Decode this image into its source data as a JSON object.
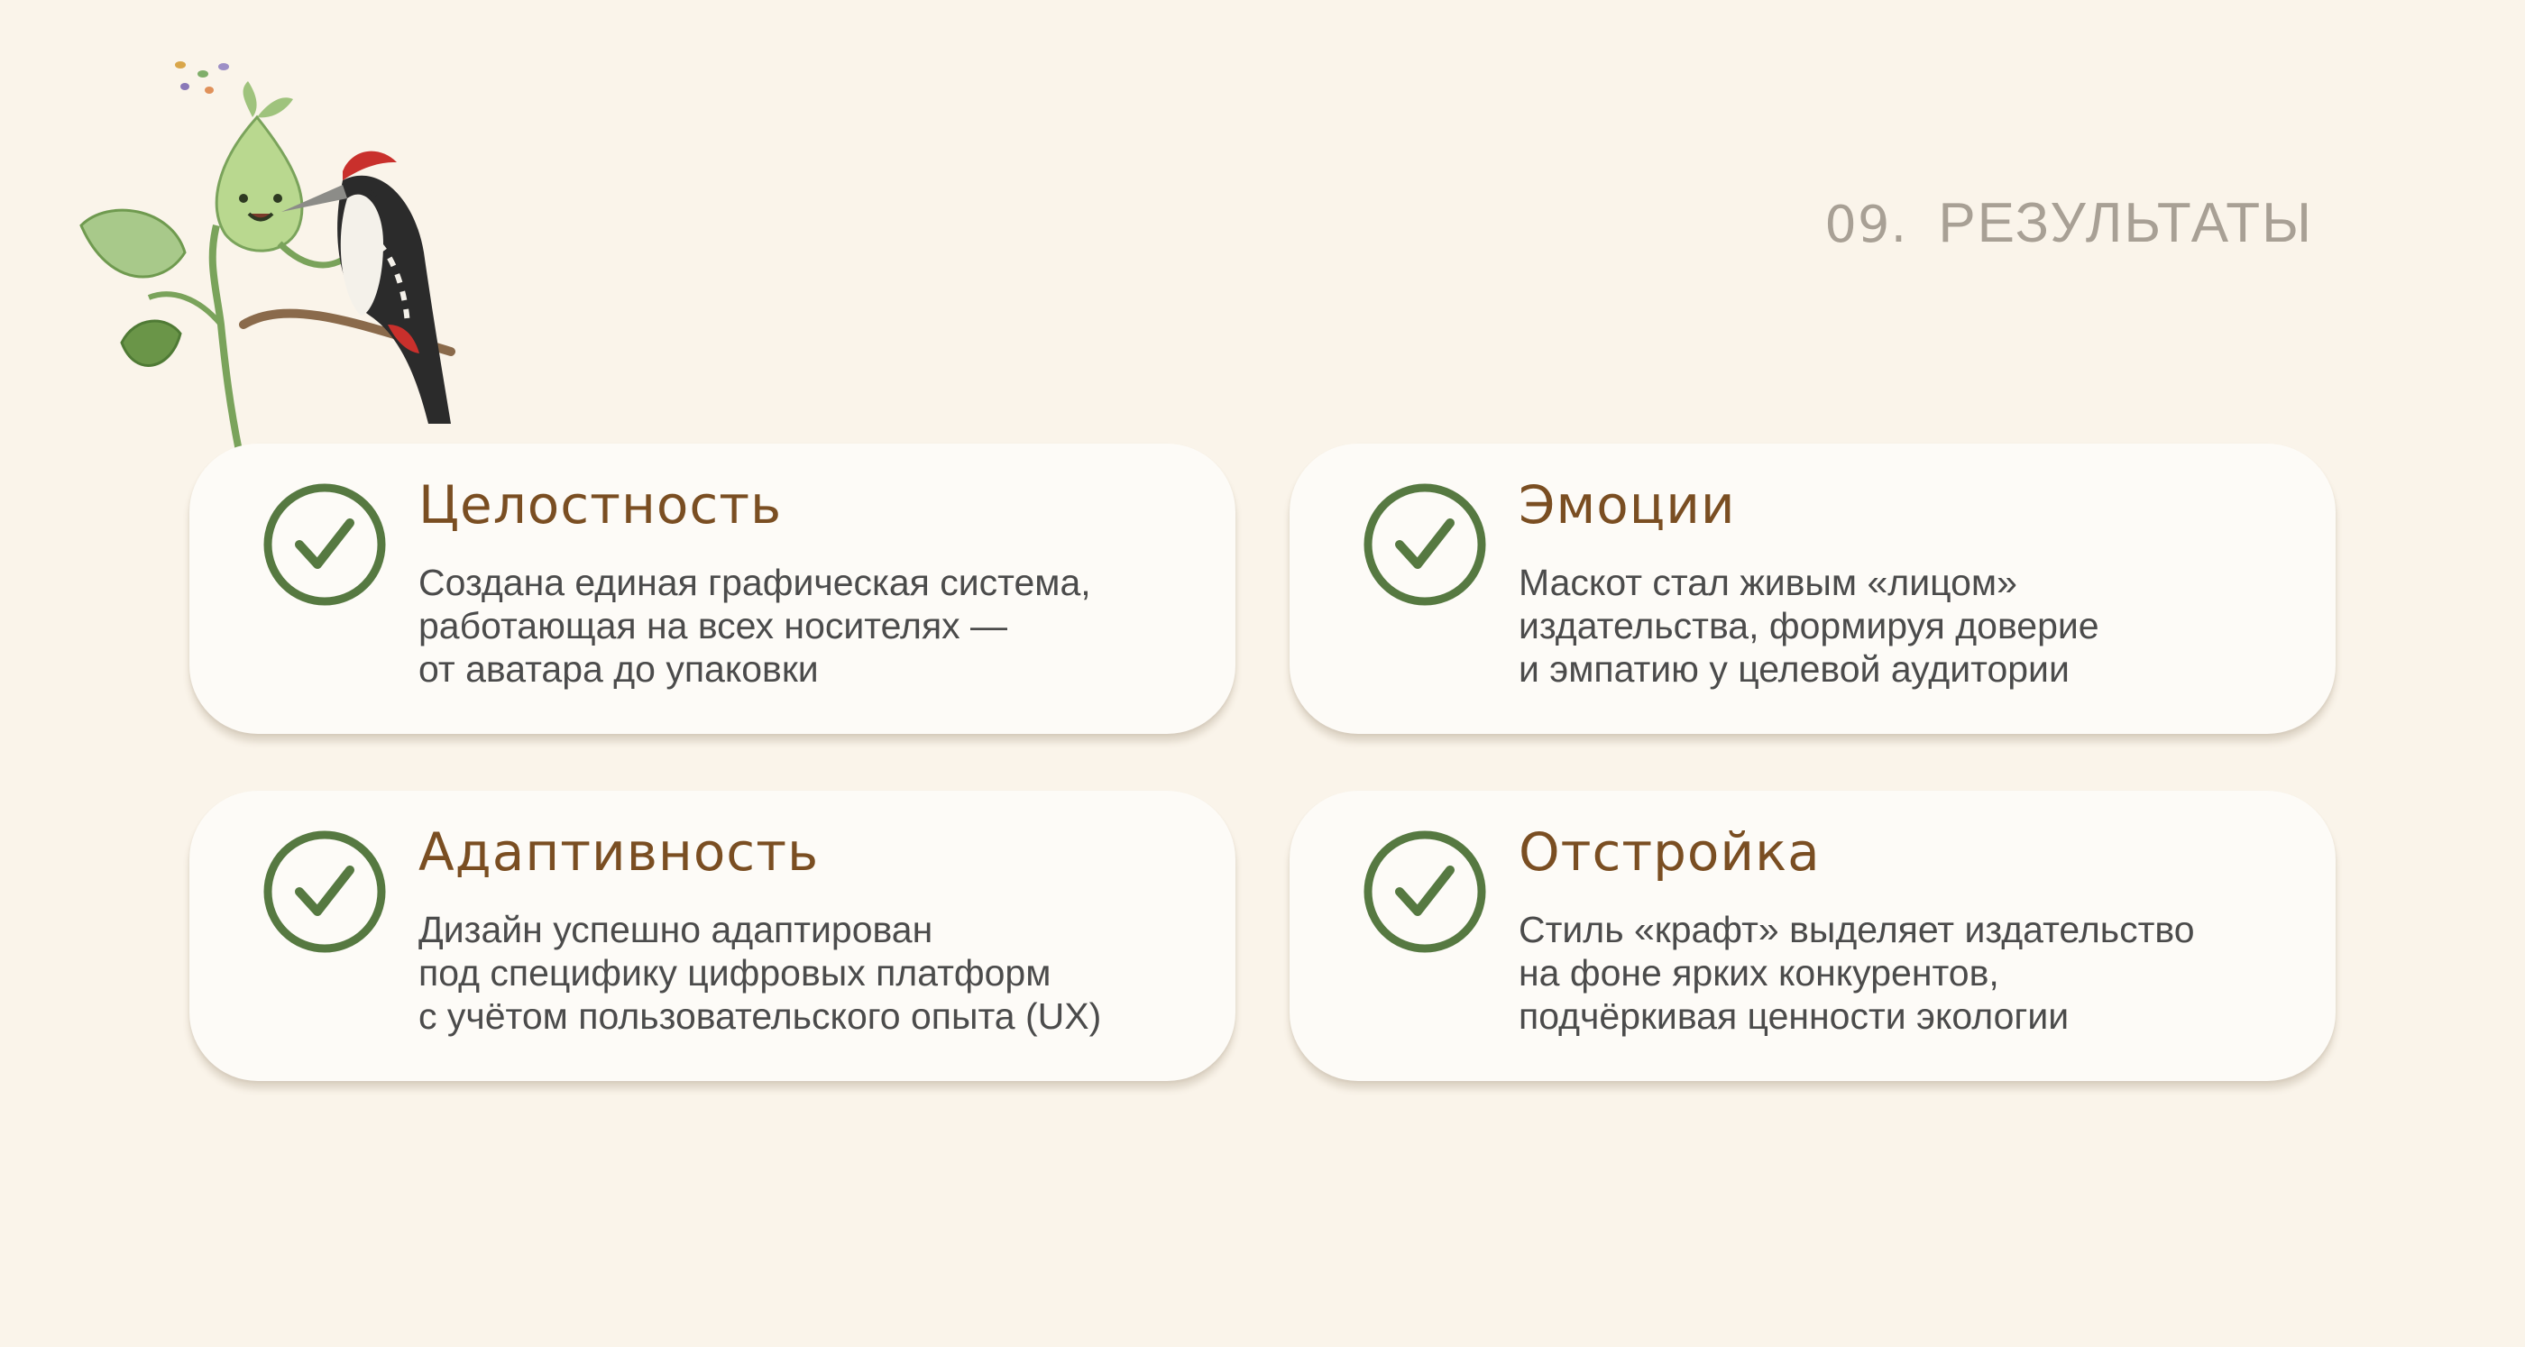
{
  "header": {
    "number": "09.",
    "title": "РЕЗУЛЬТАТЫ"
  },
  "colors": {
    "background": "#faf4ea",
    "card": "#fdfbf7",
    "accent_green": "#567941",
    "title_brown": "#7a4e22",
    "text": "#4b4b4b",
    "header_gray": "#a8a095"
  },
  "illustration": {
    "description_icon": "mascot-seedling-and-woodpecker"
  },
  "cards": [
    {
      "icon": "checkmark-circle-icon",
      "title": "Целостность",
      "lines": [
        "Создана единая графическая система,",
        "работающая на всех носителях —",
        "от аватара до упаковки"
      ]
    },
    {
      "icon": "checkmark-circle-icon",
      "title": "Эмоции",
      "lines": [
        "Маскот стал живым «лицом»",
        "издательства, формируя доверие",
        "и эмпатию у целевой аудитории"
      ]
    },
    {
      "icon": "checkmark-circle-icon",
      "title": "Адаптивность",
      "lines": [
        "Дизайн успешно адаптирован",
        "под специфику цифровых платформ",
        "с учётом пользовательского опыта (UX)"
      ]
    },
    {
      "icon": "checkmark-circle-icon",
      "title": "Отстройка",
      "lines": [
        "Стиль «крафт» выделяет издательство",
        "на фоне ярких конкурентов,",
        "подчёркивая ценности экологии"
      ]
    }
  ]
}
